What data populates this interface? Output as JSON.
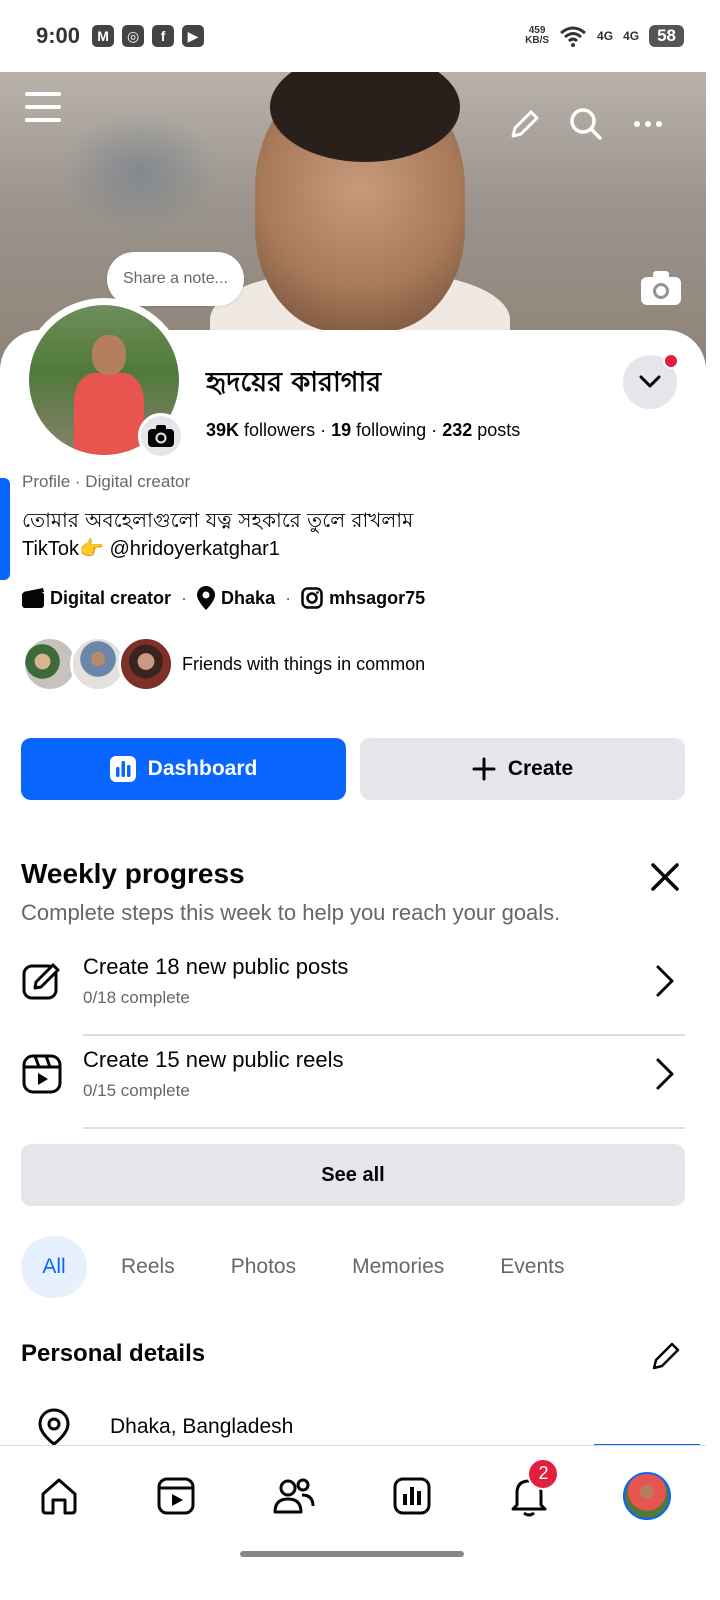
{
  "status_bar": {
    "time": "9:00",
    "apps": [
      "M",
      "◎",
      "f",
      "▶"
    ],
    "net_speed_value": "459",
    "net_speed_unit": "KB/S",
    "sim1": "4G",
    "sim2": "4G",
    "battery": "58"
  },
  "note": {
    "placeholder": "Share a note..."
  },
  "profile": {
    "name": "হৃদয়ের কারাগার",
    "followers_count": "39K",
    "followers_label": "followers",
    "following_count": "19",
    "following_label": "following",
    "posts_count": "232",
    "posts_label": "posts",
    "kind": "Profile · Digital creator",
    "bio_line1": "তোমার অবহেলাগুলো যত্ন সহকারে তুলে রাখলাম",
    "bio_line2": "TikTok👉 @hridoyerkatghar1",
    "detail_category": "Digital creator",
    "detail_location": "Dhaka",
    "detail_instagram": "mhsagor75",
    "friends_text": "Friends with things in common"
  },
  "actions": {
    "dashboard": "Dashboard",
    "create": "Create"
  },
  "weekly": {
    "title": "Weekly progress",
    "subtitle": "Complete steps this week to help you reach your goals.",
    "tasks": [
      {
        "title": "Create 18 new public posts",
        "status": "0/18 complete"
      },
      {
        "title": "Create 15 new public reels",
        "status": "0/15 complete"
      }
    ],
    "see_all": "See all"
  },
  "tabs": [
    "All",
    "Reels",
    "Photos",
    "Memories",
    "Events"
  ],
  "personal": {
    "title": "Personal details",
    "location": "Dhaka, Bangladesh"
  },
  "nav": {
    "notifications_badge": "2"
  },
  "colors": {
    "accent": "#0866ff",
    "badge": "#e41e3f",
    "secondary_text": "#65676b"
  }
}
